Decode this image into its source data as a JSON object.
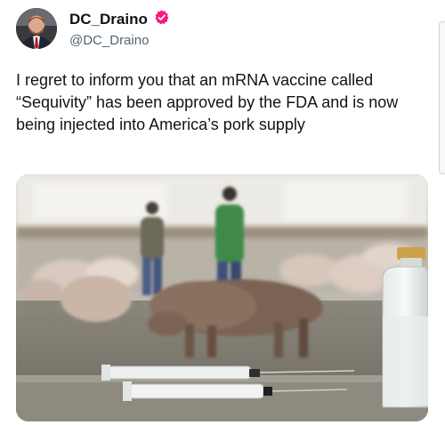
{
  "tweet": {
    "author": {
      "display_name": "DC_Draino",
      "handle": "@DC_Draino",
      "verified": true,
      "verified_badge_color": "#f91880"
    },
    "text": "I regret to inform you that an mRNA vaccine called “Sequivity” has been approved by the FDA and is now being injected into America’s pork supply",
    "media": {
      "icon": "photo"
    }
  },
  "colors": {
    "text_primary": "#0f1419",
    "text_secondary": "#536471",
    "background": "#ffffff"
  }
}
